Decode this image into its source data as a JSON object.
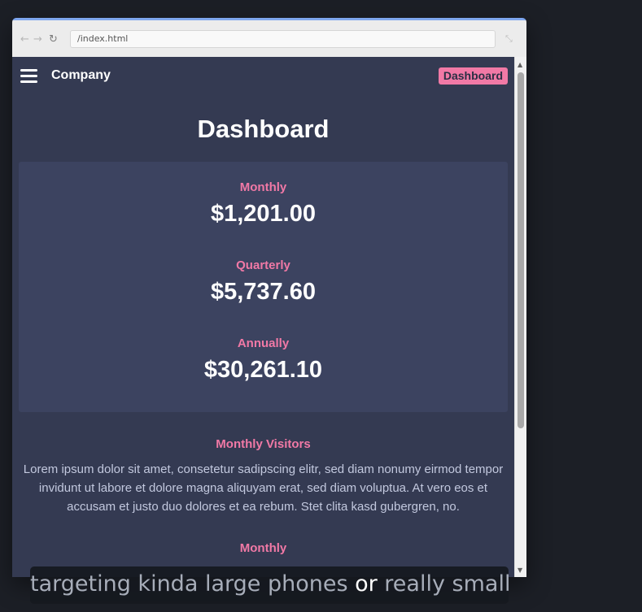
{
  "browser": {
    "url": "/index.html",
    "back_icon": "arrow-left-icon",
    "forward_icon": "arrow-right-icon",
    "reload_icon": "reload-icon",
    "expand_icon": "expand-icon"
  },
  "navbar": {
    "menu_icon": "hamburger-icon",
    "brand": "Company",
    "badge": "Dashboard"
  },
  "page": {
    "title": "Dashboard",
    "stats": [
      {
        "label": "Monthly",
        "value": "$1,201.00"
      },
      {
        "label": "Quarterly",
        "value": "$5,737.60"
      },
      {
        "label": "Annually",
        "value": "$30,261.10"
      }
    ],
    "visitors": {
      "title": "Monthly Visitors",
      "text": "Lorem ipsum dolor sit amet, consetetur sadipscing elitr, sed diam nonumy eirmod tempor invidunt ut labore et dolore magna aliquyam erat, sed diam voluptua. At vero eos et accusam et justo duo dolores et ea rebum. Stet clita kasd gubergren, no."
    },
    "next_section": {
      "title": "Monthly"
    }
  },
  "caption": {
    "part1": "targeting kinda large phones ",
    "highlight": "or",
    "part2": " really small"
  },
  "colors": {
    "accent": "#f179a6",
    "page_bg": "#343a52",
    "card_bg": "#3c4360",
    "browser_accent": "#7ea6ee"
  }
}
